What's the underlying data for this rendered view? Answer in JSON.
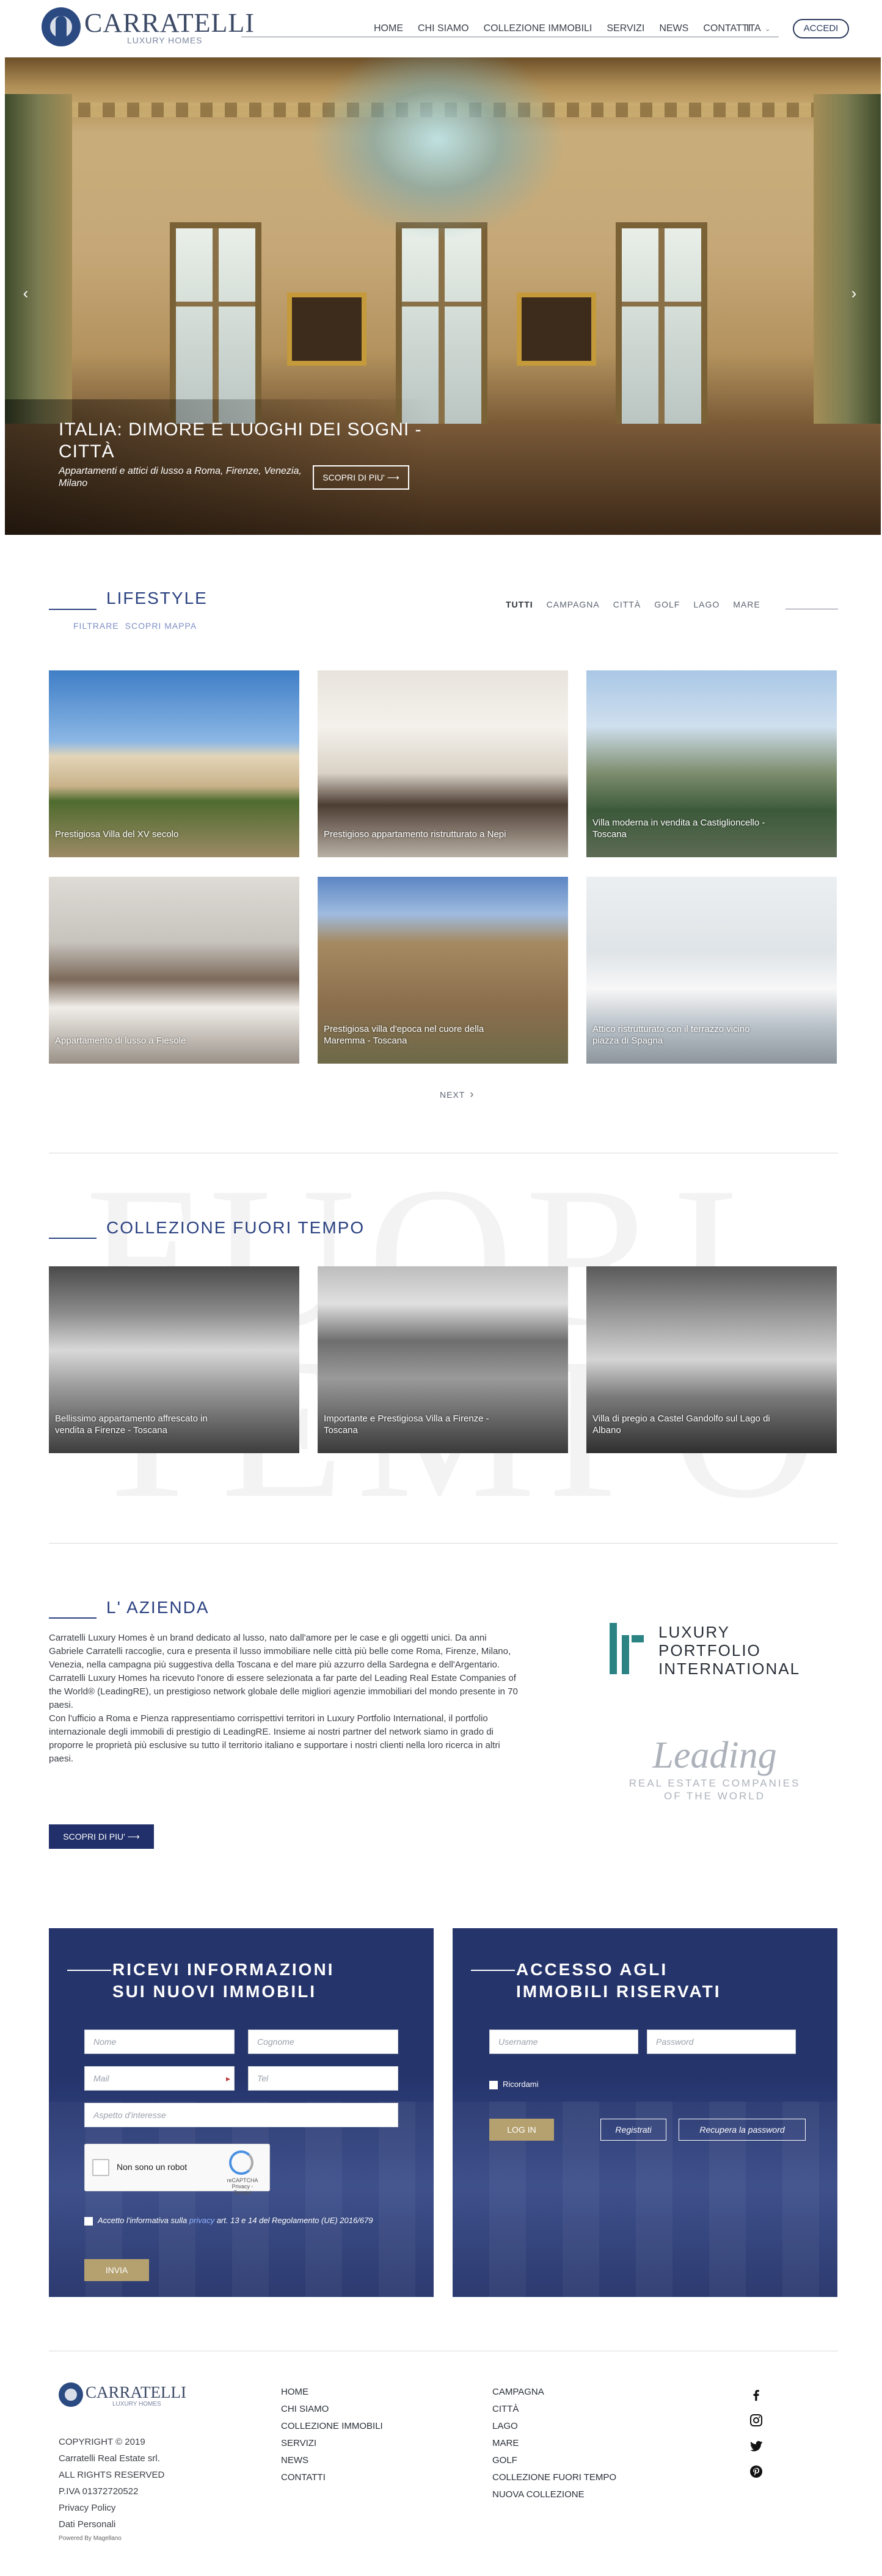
{
  "header": {
    "logo_name": "CARRATELLI",
    "logo_sub": "LUXURY HOMES",
    "nav": [
      "HOME",
      "CHI SIAMO",
      "COLLEZIONE IMMOBILI",
      "SERVIZI",
      "NEWS",
      "CONTATTI"
    ],
    "lang": "ITA",
    "login_label": "ACCEDI"
  },
  "hero": {
    "title": "ITALIA: DIMORE E LUOGHI DEI SOGNI - CITTÀ",
    "subtitle": "Appartamenti e attici di lusso a Roma, Firenze, Venezia, Milano",
    "button": "SCOPRI DI PIU'"
  },
  "lifestyle": {
    "title": "LIFESTYLE",
    "links": [
      "FILTRARE",
      "SCOPRI MAPPA"
    ],
    "tabs": [
      "TUTTI",
      "CAMPAGNA",
      "CITTÀ",
      "GOLF",
      "LAGO",
      "MARE"
    ],
    "cards": [
      "Prestigiosa Villa del XV secolo",
      "Prestigioso appartamento ristrutturato a Nepi",
      "Villa moderna in vendita a Castiglioncello - Toscana",
      "Appartamento di lusso a Fiesole",
      "Prestigiosa villa d'epoca nel cuore della Maremma - Toscana",
      "Attico ristrutturato con il terrazzo vicino piazza di Spagna"
    ],
    "next_label": "NEXT"
  },
  "collezione": {
    "title": "COLLEZIONE FUORI TEMPO",
    "watermark": "FUORI TEMPO",
    "cards": [
      "Bellissimo appartamento affrescato in vendita a Firenze - Toscana",
      "Importante e Prestigiosa Villa a Firenze - Toscana",
      "Villa di pregio a Castel Gandolfo sul Lago di Albano"
    ]
  },
  "azienda": {
    "title": "L' AZIENDA",
    "paragraphs": [
      "Carratelli Luxury Homes è un brand dedicato al lusso, nato dall'amore per le case e gli oggetti unici. Da anni Gabriele Carratelli raccoglie, cura e presenta il lusso immobiliare nelle città più belle come Roma, Firenze, Milano, Venezia, nella campagna più suggestiva della Toscana e del mare più azzurro della Sardegna e dell'Argentario.",
      "Carratelli Luxury Homes ha ricevuto l'onore di essere selezionata a far parte del Leading Real Estate Companies of the World® (LeadingRE), un prestigioso network globale delle migliori agenzie immobiliari del mondo presente in 70 paesi.",
      "Con l'ufficio a Roma e Pienza rappresentiamo corrispettivi territori in Luxury Portfolio International, il portfolio internazionale degli immobili di prestigio di LeadingRE. Insieme ai nostri partner del network siamo in grado di proporre le proprietà più esclusive su tutto il territorio italiano e supportare i nostri clienti nella loro ricerca in altri paesi."
    ],
    "button": "SCOPRI DI PIU'",
    "lpi_lines": [
      "LUXURY",
      "PORTFOLIO",
      "INTERNATIONAL"
    ],
    "lre_big": "Leading",
    "lre_small_1": "REAL ESTATE COMPANIES",
    "lre_small_2": "OF THE WORLD"
  },
  "form_info": {
    "title_line1": "RICEVI INFORMAZIONI",
    "title_line2": "SUI NUOVI IMMOBILI",
    "nome": "Nome",
    "cognome": "Cognome",
    "mail": "Mail",
    "tel": "Tel",
    "aspetto": "Aspetto d'interesse",
    "recaptcha_label": "Non sono un robot",
    "recaptcha_small": "reCAPTCHA Privacy - Termini",
    "privacy_pre": "Accetto l'informativa sulla",
    "privacy_link": "privacy",
    "privacy_post": "art. 13 e 14 del Regolamento (UE) 2016/679",
    "submit": "INVIA"
  },
  "form_access": {
    "title_line1": "ACCESSO AGLI",
    "title_line2": "IMMOBILI RISERVATI",
    "username": "Username",
    "password": "Password",
    "remember": "Ricordami",
    "login": "LOG IN",
    "register": "Registrati",
    "recover": "Recupera la password"
  },
  "footer": {
    "logo_name": "CARRATELLI",
    "logo_sub": "LUXURY HOMES",
    "copy": [
      "COPYRIGHT © 2019",
      "Carratelli Real Estate srl.",
      "ALL RIGHTS RESERVED",
      "P.IVA 01372720522",
      "Privacy Policy",
      "Dati Personali"
    ],
    "powered": "Powered By Magellano",
    "col1": [
      "HOME",
      "CHI SIAMO",
      "COLLEZIONE IMMOBILI",
      "SERVIZI",
      "NEWS",
      "CONTATTI"
    ],
    "col2": [
      "CAMPAGNA",
      "CITTÀ",
      "LAGO",
      "MARE",
      "GOLF",
      "COLLEZIONE FUORI TEMPO",
      "NUOVA COLLEZIONE"
    ],
    "social": [
      "facebook-icon",
      "instagram-icon",
      "twitter-icon",
      "pinterest-icon"
    ]
  },
  "colors": {
    "brand_blue": "#2b4281",
    "panel_blue": "#25346b",
    "gold_button": "#b5a170",
    "lpi_teal": "#2b8384"
  }
}
